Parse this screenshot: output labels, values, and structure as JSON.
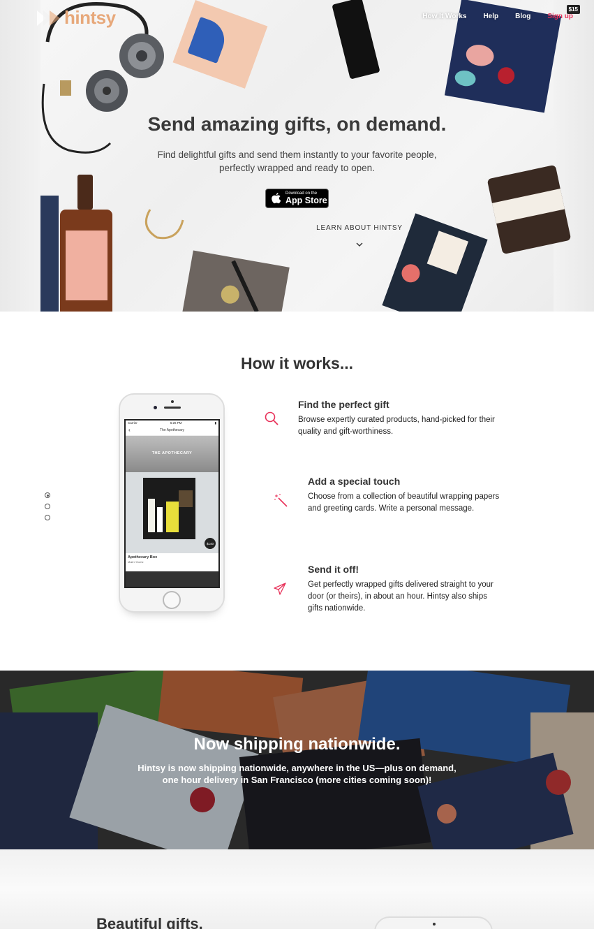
{
  "brand": {
    "name": "hintsy"
  },
  "nav": {
    "items": [
      {
        "label": "How It Works"
      },
      {
        "label": "Help"
      },
      {
        "label": "Blog"
      },
      {
        "label": "Sign up"
      }
    ],
    "credit_badge": "$15"
  },
  "hero": {
    "title": "Send amazing gifts, on demand.",
    "subtitle": "Find delightful gifts and send them instantly to your favorite people, perfectly wrapped and ready to open.",
    "appstore_small": "Download on the",
    "appstore_big": "App Store",
    "learn_more": "LEARN ABOUT HINTSY"
  },
  "how": {
    "title": "How it works...",
    "steps": [
      {
        "title": "Find the perfect gift",
        "text": "Browse expertly curated products, hand-picked for their quality and gift-worthiness.",
        "icon": "search-icon"
      },
      {
        "title": "Add a special touch",
        "text": "Choose from a collection of beautiful wrapping papers and greeting cards. Write a personal message.",
        "icon": "magic-wand-icon"
      },
      {
        "title": "Send it off!",
        "text": "Get perfectly wrapped gifts delivered straight to your door (or theirs), in about an hour. Hintsy also ships gifts nationwide.",
        "icon": "paper-plane-icon"
      }
    ],
    "phone": {
      "carrier": "Carrier",
      "time": "6:26 PM",
      "screen_title": "The Apothecary",
      "banner": "THE APOTHECARY",
      "price": "$140",
      "product_name": "Apothecary Box",
      "product_vendor": "Malin+Goetz"
    }
  },
  "band": {
    "title": "Now shipping nationwide.",
    "text": "Hintsy is now shipping nationwide, anywhere in the US—plus on demand, one hour delivery in San Francisco (more cities coming soon)!"
  },
  "gifts": {
    "title": "Beautiful gifts."
  },
  "colors": {
    "accent": "#e8325a",
    "brand": "#e7a87a",
    "text": "#333333"
  }
}
